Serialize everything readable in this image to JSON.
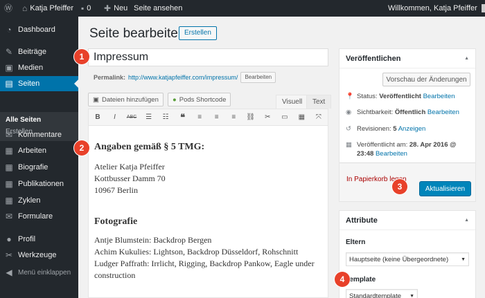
{
  "adminbar": {
    "site_name": "Katja Pfeiffer",
    "comments_count": "0",
    "new_label": "Neu",
    "view_page": "Seite ansehen",
    "welcome": "Willkommen, Katja Pfeiffer",
    "wp_icon": "wordpress-logo-icon",
    "home_icon": "home-icon",
    "comment_icon": "comment-bubble-icon",
    "plus_icon": "plus-icon",
    "avatar_icon": "user-avatar-icon"
  },
  "menu": {
    "items": [
      {
        "label": "Dashboard",
        "icon": "dashboard-icon"
      },
      {
        "label": "Beiträge",
        "icon": "pin-icon"
      },
      {
        "label": "Medien",
        "icon": "media-icon"
      },
      {
        "label": "Seiten",
        "icon": "pages-icon"
      },
      {
        "label": "Kommentare",
        "icon": "comments-icon"
      },
      {
        "label": "Arbeiten",
        "icon": "portfolio-icon"
      },
      {
        "label": "Biografie",
        "icon": "list-icon"
      },
      {
        "label": "Publikationen",
        "icon": "list-icon"
      },
      {
        "label": "Zyklen",
        "icon": "list-icon"
      },
      {
        "label": "Formulare",
        "icon": "mail-icon"
      },
      {
        "label": "Profil",
        "icon": "user-icon"
      },
      {
        "label": "Werkzeuge",
        "icon": "wrench-icon"
      }
    ],
    "sub": [
      "Alle Seiten",
      "Erstellen"
    ],
    "collapse": "Menü einklappen"
  },
  "page": {
    "title": "Seite bearbeiten",
    "create_button": "Erstellen"
  },
  "editor": {
    "title_value": "Impressum",
    "permalink_label": "Permalink:",
    "permalink_url": "http://www.katjapfeiffer.com/impressum/",
    "permalink_edit": "Bearbeiten",
    "add_media": "Dateien hinzufügen",
    "pods_shortcode": "Pods Shortcode",
    "tab_visual": "Visuell",
    "tab_text": "Text",
    "toolbar": [
      "B",
      "I",
      "ABC",
      "list-bullet-icon",
      "list-number-icon",
      "quote-icon",
      "align-left-icon",
      "align-center-icon",
      "align-right-icon",
      "link-icon",
      "unlink-icon",
      "more-icon",
      "kitchen-sink-icon",
      "fullscreen-icon"
    ],
    "heading1": "Angaben gemäß § 5 TMG:",
    "address": [
      "Atelier Katja Pfeiffer",
      "Kottbusser Damm 70",
      "10967 Berlin"
    ],
    "heading2": "Fotografie",
    "credits": [
      "Antje Blumstein: Backdrop Bergen",
      "Achim Kukulies: Lightson, Backdrop Düsseldorf, Rohschnitt",
      "Ludger Paffrath: Irrlicht, Rigging, Backdrop Pankow, Eagle under construction"
    ]
  },
  "publish": {
    "title": "Veröffentlichen",
    "preview": "Vorschau der Änderungen",
    "status_label": "Status:",
    "status_value": "Veröffentlicht",
    "status_edit": "Bearbeiten",
    "visibility_label": "Sichtbarkeit:",
    "visibility_value": "Öffentlich",
    "visibility_edit": "Bearbeiten",
    "revisions_label": "Revisionen:",
    "revisions_value": "5",
    "revisions_link": "Anzeigen",
    "published_label": "Veröffentlicht am:",
    "published_value": "28. Apr 2016 @",
    "published_time": "23:48",
    "published_edit": "Bearbeiten",
    "trash": "In Papierkorb legen",
    "update": "Aktualisieren"
  },
  "attributes": {
    "title": "Attribute",
    "parent_label": "Eltern",
    "parent_value": "Hauptseite (keine Übergeordnete)",
    "template_label": "Template",
    "template_value": "Standardtemplate"
  },
  "badges": [
    "1",
    "2",
    "3",
    "4"
  ],
  "colors": {
    "accent": "#0073aa",
    "badge": "#e8412a",
    "adminbar": "#23282d"
  }
}
